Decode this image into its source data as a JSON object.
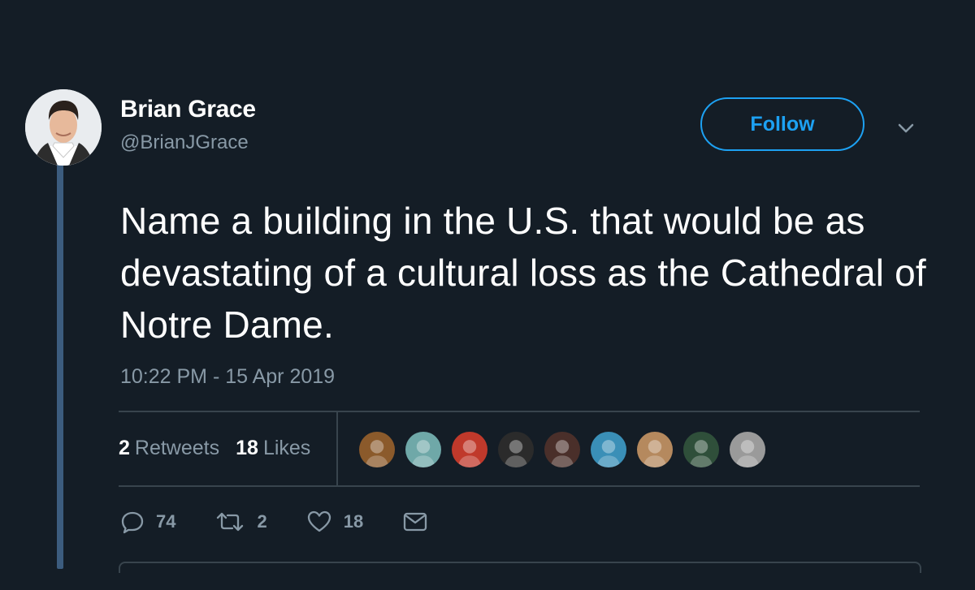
{
  "author": {
    "name": "Brian Grace",
    "handle": "@BrianJGrace",
    "avatar_icon": "profile-photo"
  },
  "follow_button": {
    "label": "Follow",
    "color": "#1da1f2"
  },
  "menu_icon": "chevron-down-icon",
  "tweet": {
    "text": "Name a building in the U.S. that would be as devastating of a cultural loss as the Cathedral of Notre Dame.",
    "timestamp": "10:22 PM - 15 Apr 2019"
  },
  "stats": {
    "retweets_count": "2",
    "retweets_label": "Retweets",
    "likes_count": "18",
    "likes_label": "Likes"
  },
  "liker_avatars": [
    {
      "color": "#8b5a2b"
    },
    {
      "color": "#6fa8a8"
    },
    {
      "color": "#c0392b"
    },
    {
      "color": "#2b2b2b"
    },
    {
      "color": "#4a2f2a"
    },
    {
      "color": "#3a8fb7"
    },
    {
      "color": "#b5895e"
    },
    {
      "color": "#2f4f3a"
    },
    {
      "color": "#9a9a9a"
    }
  ],
  "actions": {
    "reply_count": "74",
    "retweet_count": "2",
    "like_count": "18"
  },
  "colors": {
    "background": "#141d26",
    "secondary_text": "#8899a6",
    "accent": "#1da1f2",
    "thread_line": "#3c5c7e",
    "divider": "#38444d"
  }
}
